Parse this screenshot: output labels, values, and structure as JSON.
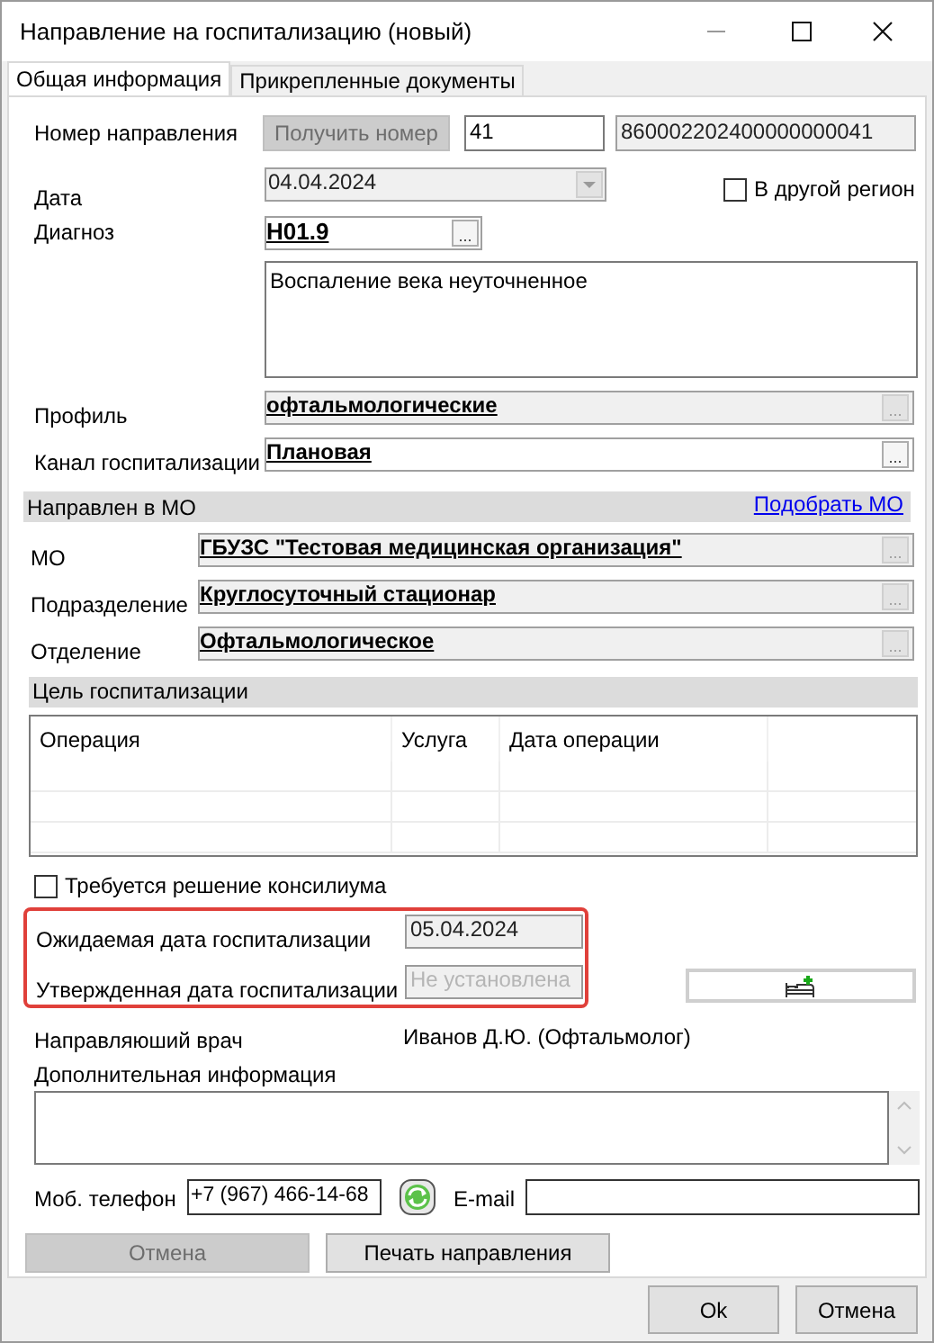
{
  "window": {
    "title": "Направление на госпитализацию (новый)"
  },
  "tabs": [
    {
      "label": "Общая информация",
      "selected": true
    },
    {
      "label": "Прикрепленные документы",
      "selected": false
    }
  ],
  "referral_number": {
    "label": "Номер направления",
    "button": "Получить номер",
    "button_disabled": true,
    "number": "41",
    "full_number": "860002202400000000041"
  },
  "date": {
    "label": "Дата",
    "value": "04.04.2024"
  },
  "other_region": {
    "label": "В другой регион",
    "checked": false
  },
  "diagnosis": {
    "label": "Диагноз",
    "code": "H01.9",
    "button": "...",
    "description": "Воспаление века неуточненное"
  },
  "lookups": [
    {
      "label": "Профиль",
      "value": "офтальмологические",
      "button": "...",
      "disabled": true
    },
    {
      "label": "Канал госпитализации",
      "value": "Плановая",
      "button": "...",
      "disabled": false
    }
  ],
  "mo_section": {
    "title": "Направлен в МО",
    "link": "Подобрать МО",
    "fields": [
      {
        "label": "МО",
        "value": "ГБУЗС \"Тестовая медицинская организация\"",
        "button": "...",
        "disabled": true
      },
      {
        "label": "Подразделение",
        "value": "Круглосуточный стационар",
        "button": "...",
        "disabled": true
      },
      {
        "label": "Отделение",
        "value": "Офтальмологическое",
        "button": "...",
        "disabled": true
      }
    ]
  },
  "goal_section": {
    "title": "Цель госпитализации",
    "table": {
      "columns": [
        "Операция",
        "Услуга",
        "Дата операции"
      ]
    }
  },
  "council": {
    "label": "Требуется решение консилиума",
    "checked": false
  },
  "hospitalization_dates": [
    {
      "label": "Ожидаемая дата госпитализации",
      "value": "05.04.2024",
      "disabled": false
    },
    {
      "label": "Утвержденная дата госпитализации",
      "value": "Не установлена",
      "disabled": true
    }
  ],
  "referring_doctor": {
    "label": "Направляюший врач",
    "value": "Иванов Д.Ю. (Офтальмолог)"
  },
  "additional_info": {
    "label": "Дополнительная информация"
  },
  "phone": {
    "label": "Моб. телефон",
    "value": "+7 (967) 466-14-68"
  },
  "email": {
    "label": "E-mail"
  },
  "actions": [
    {
      "label": "Отмена",
      "disabled": true
    },
    {
      "label": "Печать направления",
      "disabled": false
    }
  ],
  "dialog_buttons": [
    "Ok",
    "Отмена"
  ]
}
